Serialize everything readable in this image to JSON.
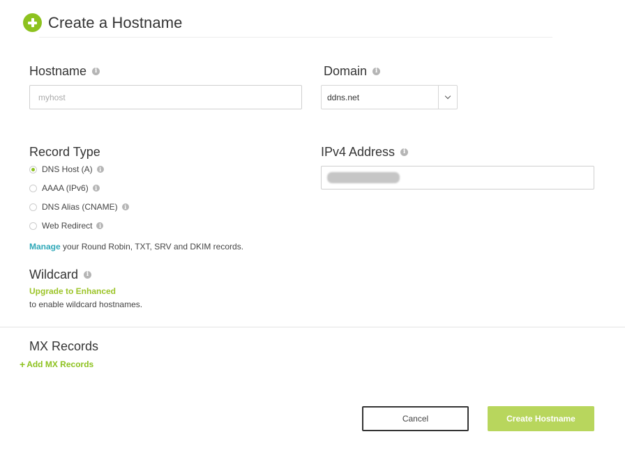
{
  "header": {
    "title": "Create a Hostname",
    "icon": "plus-circle-icon",
    "accent_color": "#8dc21f"
  },
  "hostname": {
    "label": "Hostname",
    "placeholder": "myhost",
    "value": ""
  },
  "domain": {
    "label": "Domain",
    "selected": "ddns.net"
  },
  "record_type": {
    "label": "Record Type",
    "options": [
      {
        "label": "DNS Host (A)",
        "checked": true,
        "info": true
      },
      {
        "label": "AAAA (IPv6)",
        "checked": false,
        "info": true
      },
      {
        "label": "DNS Alias (CNAME)",
        "checked": false,
        "info": true
      },
      {
        "label": "Web Redirect",
        "checked": false,
        "info": true
      }
    ]
  },
  "ipv4": {
    "label": "IPv4 Address",
    "value_redacted": true
  },
  "manage": {
    "link": "Manage",
    "text": " your Round Robin, TXT, SRV and DKIM records."
  },
  "wildcard": {
    "label": "Wildcard",
    "upgrade_link": "Upgrade to Enhanced",
    "description": "to enable wildcard hostnames."
  },
  "mx": {
    "label": "MX Records",
    "add_link": "Add MX Records"
  },
  "actions": {
    "cancel_label": "Cancel",
    "create_label": "Create Hostname"
  },
  "info_glyph": "i"
}
